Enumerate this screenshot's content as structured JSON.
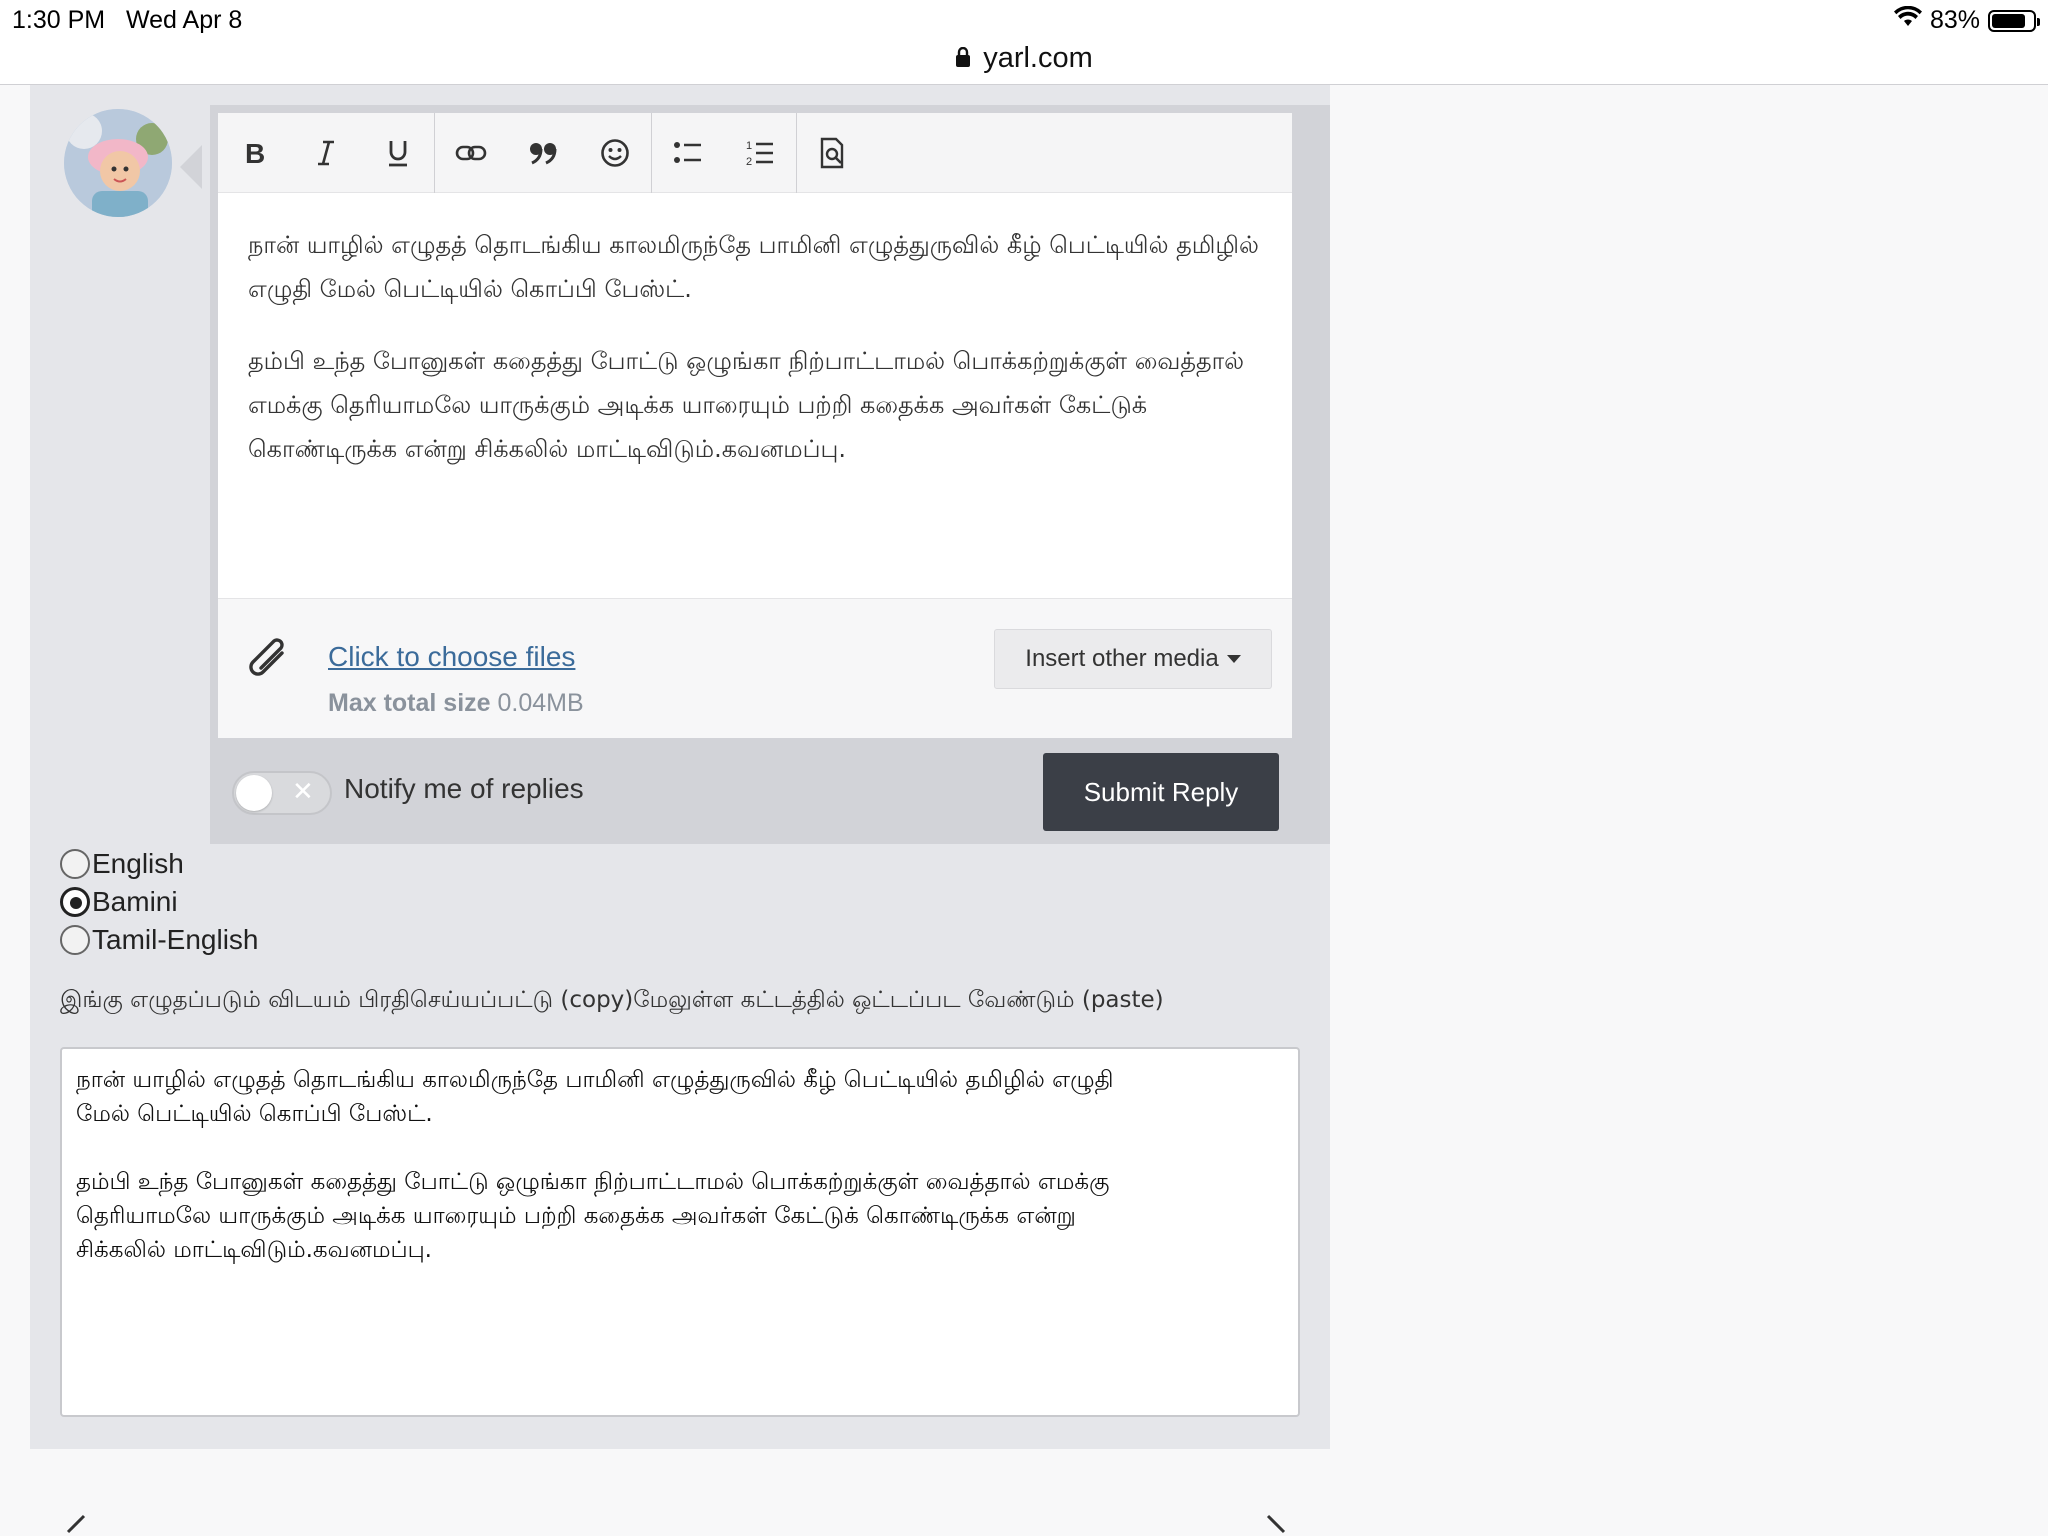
{
  "status": {
    "time": "1:30 PM",
    "date": "Wed Apr 8",
    "battery": "83%",
    "battery_level": 0.83
  },
  "browser": {
    "url": "yarl.com"
  },
  "toolbar": {
    "items": [
      "bold-icon",
      "italic-icon",
      "underline-icon",
      "link-icon",
      "quote-icon",
      "emoji-icon",
      "bullet-list-icon",
      "numbered-list-icon",
      "preview-icon"
    ]
  },
  "editor": {
    "paragraphs": [
      "நான் யாழில் எழுதத் தொடங்கிய காலமிருந்தே பாமினி எழுத்துருவில் கீழ் பெட்டியில் தமிழில் எழுதி மேல் பெட்டியில் கொப்பி பேஸ்ட்.",
      "தம்பி உந்த போனுகள் கதைத்து போட்டு ஒழுங்கா நிற்பாட்டாமல் பொக்கற்றுக்குள் வைத்தால் எமக்கு தெரியாமலே யாருக்கும் அடிக்க யாரையும் பற்றி கதைக்க அவர்கள் கேட்டுக் கொண்டிருக்க என்று சிக்கலில் மாட்டிவிடும்.கவனமப்பு."
    ]
  },
  "attachments": {
    "choose_label": "Click to choose files",
    "max_size_label": "Max total size",
    "max_size_value": "0.04MB",
    "insert_media_label": "Insert other media"
  },
  "reply": {
    "notify_label": "Notify me of replies",
    "notify_on": false,
    "submit_label": "Submit Reply"
  },
  "keyboard_options": [
    {
      "label": "English",
      "checked": false
    },
    {
      "label": "Bamini",
      "checked": true
    },
    {
      "label": "Tamil-English",
      "checked": false
    }
  ],
  "instruction": "இங்கு எழுதப்படும் விடயம் பிரதிசெய்யப்பட்டு (copy)மேலுள்ள கட்டத்தில் ஒட்டப்பட வேண்டும் (paste)",
  "source_text": "நான் யாழில் எழுதத் தொடங்கிய காலமிருந்தே பாமினி எழுத்துருவில் கீழ் பெட்டியில் தமிழில் எழுதி\nமேல் பெட்டியில் கொப்பி பேஸ்ட்.\n\nதம்பி உந்த போனுகள் கதைத்து போட்டு ஒழுங்கா நிற்பாட்டாமல் பொக்கற்றுக்குள் வைத்தால் எமக்கு\nதெரியாமலே யாருக்கும் அடிக்க யாரையும் பற்றி கதைக்க அவர்கள் கேட்டுக் கொண்டிருக்க என்று\nசிக்கலில் மாட்டிவிடும்.கவனமப்பு."
}
